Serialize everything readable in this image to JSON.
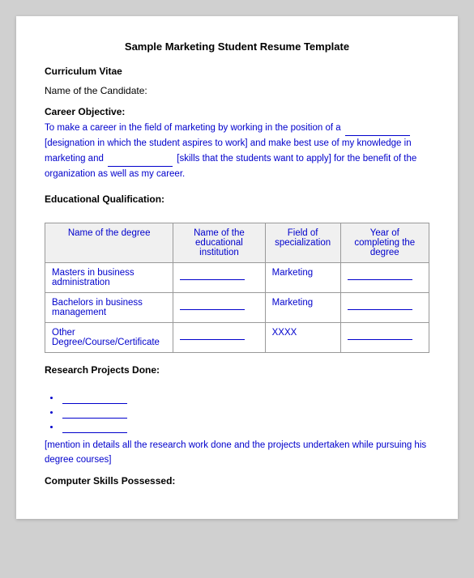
{
  "title": "Sample Marketing Student Resume Template",
  "sections": {
    "curriculum_vitae": "Curriculum Vitae",
    "candidate_name_label": "Name of the Candidate:",
    "career_objective_label": "Career Objective:",
    "career_objective_text_1": "To make a career in the field of marketing by working in the position of a",
    "career_objective_text_2": "[designation in which the student aspires to work] and make best use of my knowledge in marketing and",
    "career_objective_text_3": "[skills that the students want to apply] for the benefit of the organization as well as my career.",
    "edu_qual_label": "Educational Qualification:",
    "edu_table": {
      "headers": [
        "Name of the degree",
        "Name of the educational institution",
        "Field of specialization",
        "Year of completing the degree"
      ],
      "rows": [
        {
          "degree": "Masters in business administration",
          "institution": "",
          "field": "Marketing",
          "year": ""
        },
        {
          "degree": "Bachelors in business management",
          "institution": "",
          "field": "Marketing",
          "year": ""
        },
        {
          "degree": "Other Degree/Course/Certificate",
          "institution": "",
          "field": "XXXX",
          "year": ""
        }
      ]
    },
    "research_label": "Research Projects Done:",
    "research_bullets": [
      "",
      "",
      ""
    ],
    "research_note": "[mention in details all the research work done and the projects undertaken while pursuing his degree courses]",
    "computer_skills_label": "Computer Skills Possessed:"
  }
}
